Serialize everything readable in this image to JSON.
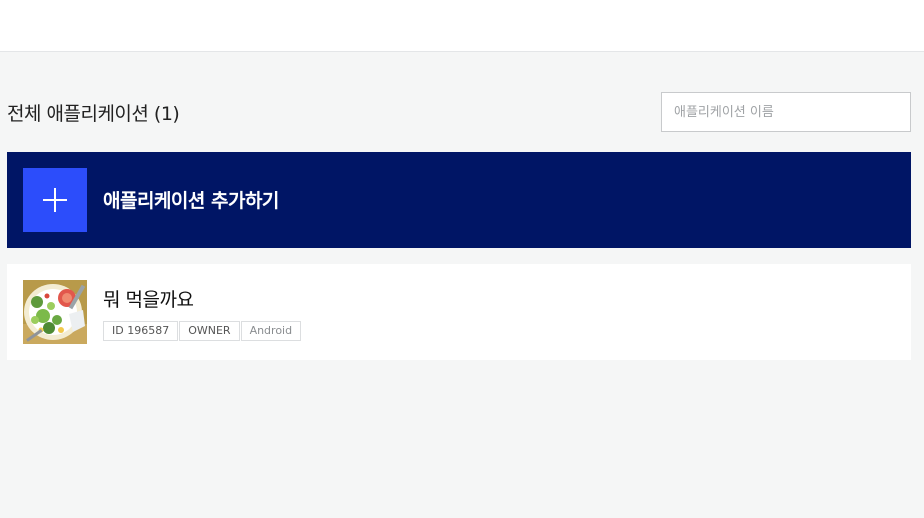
{
  "header": {},
  "list": {
    "title": "전체 애플리케이션 (1)",
    "search_placeholder": "애플리케이션 이름"
  },
  "add_app": {
    "label": "애플리케이션 추가하기",
    "icon": "plus-icon"
  },
  "apps": [
    {
      "name": "뭐 먹을까요",
      "thumbnail": "salad-plate-image",
      "tags": {
        "id": "ID 196587",
        "role": "OWNER",
        "platform": "Android"
      }
    }
  ],
  "colors": {
    "page_bg": "#f5f6f6",
    "add_banner_bg": "#001565",
    "add_icon_bg": "#2c4dfb",
    "card_bg": "#ffffff"
  }
}
